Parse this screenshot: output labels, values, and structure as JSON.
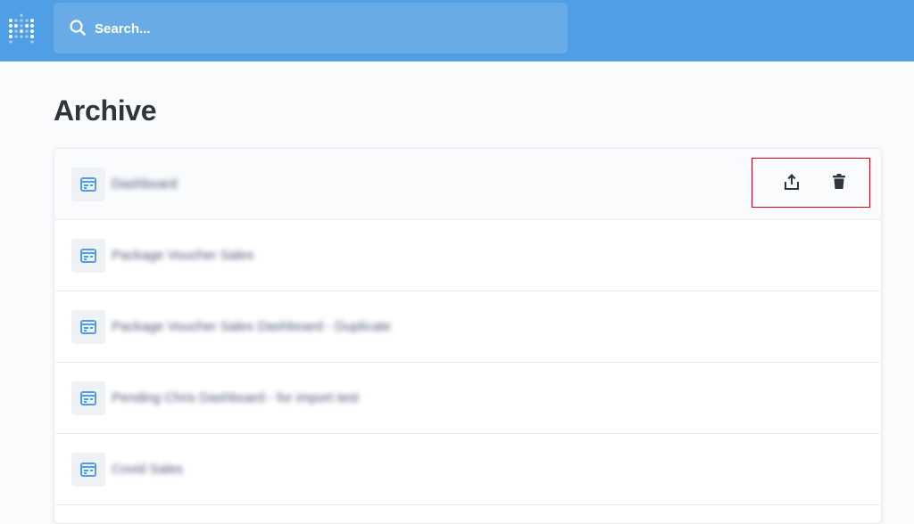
{
  "search": {
    "placeholder": "Search..."
  },
  "page": {
    "title": "Archive"
  },
  "archive": {
    "items": [
      {
        "name": "Dashboard"
      },
      {
        "name": "Package Voucher Sales"
      },
      {
        "name": "Package Voucher Sales Dashboard - Duplicate"
      },
      {
        "name": "Pending Chris Dashboard - for import test"
      },
      {
        "name": "Covid Sales"
      }
    ],
    "actions": {
      "unarchive_icon": "unarchive-icon",
      "delete_icon": "trash-icon"
    }
  },
  "colors": {
    "topbar": "#509ee3",
    "accent": "#509ee3",
    "highlight_border": "#d0021b",
    "title_text": "#2e353b"
  }
}
